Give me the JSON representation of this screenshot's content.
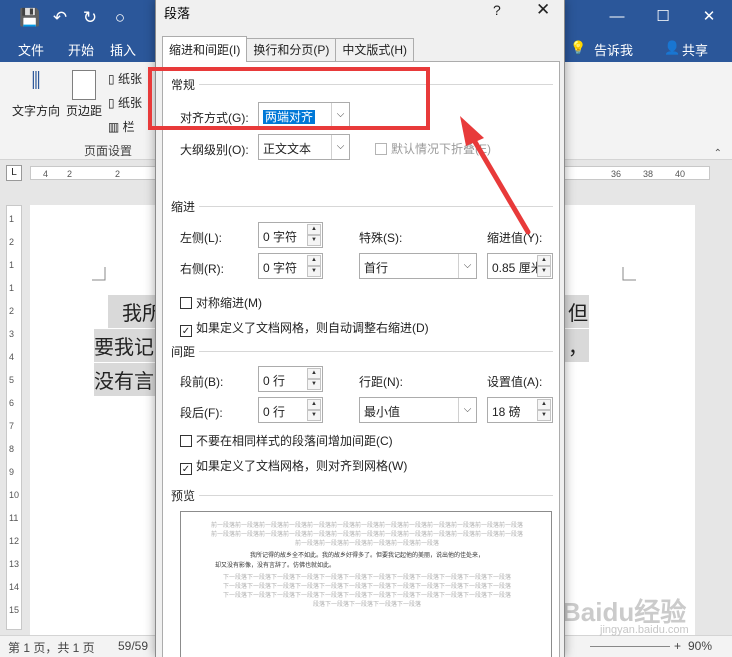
{
  "word": {
    "ribbon_tabs": [
      "文件",
      "开始",
      "插入",
      "告诉我",
      "共享"
    ],
    "ribbon_buttons": {
      "text_direction": "文字方向",
      "margins": "页边距",
      "paper1": "纸张",
      "paper2": "纸张",
      "columns": "栏"
    },
    "group_label": "页面设置",
    "ruler_numbers": [
      "4",
      "2",
      "2",
      "36",
      "38",
      "40"
    ],
    "vertical_ruler": [
      "1",
      "2",
      "1",
      "1",
      "2",
      "3",
      "4",
      "5",
      "6",
      "7",
      "8",
      "9",
      "10",
      "11",
      "12",
      "13",
      "14",
      "15"
    ],
    "doc_lines": [
      "我所",
      "要我记",
      "没有言",
      "但",
      "，"
    ],
    "status": {
      "page": "第 1 页，共 1 页",
      "words": "59/59",
      "zoom": "90%"
    },
    "watermark": "Baidu经验",
    "watermark_sub": "jingyan.baidu.com"
  },
  "dialog": {
    "title": "段落",
    "help": "?",
    "close": "✕",
    "tabs": [
      "缩进和间距(I)",
      "换行和分页(P)",
      "中文版式(H)"
    ],
    "general": {
      "heading": "常规",
      "alignment_label": "对齐方式(G):",
      "alignment_value": "两端对齐",
      "outline_label": "大纲级别(O):",
      "outline_value": "正文文本",
      "collapse_label": "默认情况下折叠(E)"
    },
    "indent": {
      "heading": "缩进",
      "left_label": "左侧(L):",
      "left_value": "0 字符",
      "right_label": "右侧(R):",
      "right_value": "0 字符",
      "special_label": "特殊(S):",
      "special_value": "首行",
      "amount_label": "缩进值(Y):",
      "amount_value": "0.85 厘米",
      "mirror_label": "对称缩进(M)",
      "auto_adjust_label": "如果定义了文档网格，则自动调整右缩进(D)"
    },
    "spacing": {
      "heading": "间距",
      "before_label": "段前(B):",
      "before_value": "0 行",
      "after_label": "段后(F):",
      "after_value": "0 行",
      "line_label": "行距(N):",
      "line_value": "最小值",
      "at_label": "设置值(A):",
      "at_value": "18 磅",
      "no_space_label": "不要在相同样式的段落间增加间距(C)",
      "snap_grid_label": "如果定义了文档网格，则对齐到网格(W)"
    },
    "preview": {
      "heading": "预览",
      "prev_line": "前一段落前一段落前一段落前一段落前一段落前一段落前一段落前一段落前一段落前一段落前一段落前一段落前一段落",
      "prev_line_short": "前一段落前一段落前一段落前一段落前一段落前一段落",
      "sample_1": "我所记得的故乡全不如此。我的故乡好得多了。但要我记起他的美丽，说出他的佳处来，",
      "sample_2": "却又没有影像，没有言辞了。仿佛也就如此。",
      "next_line": "下一段落下一段落下一段落下一段落下一段落下一段落下一段落下一段落下一段落下一段落下一段落下一段落",
      "next_line_short": "段落下一段落下一段落下一段落下一段落"
    }
  },
  "annotation": {
    "color": "#e83a3a"
  }
}
